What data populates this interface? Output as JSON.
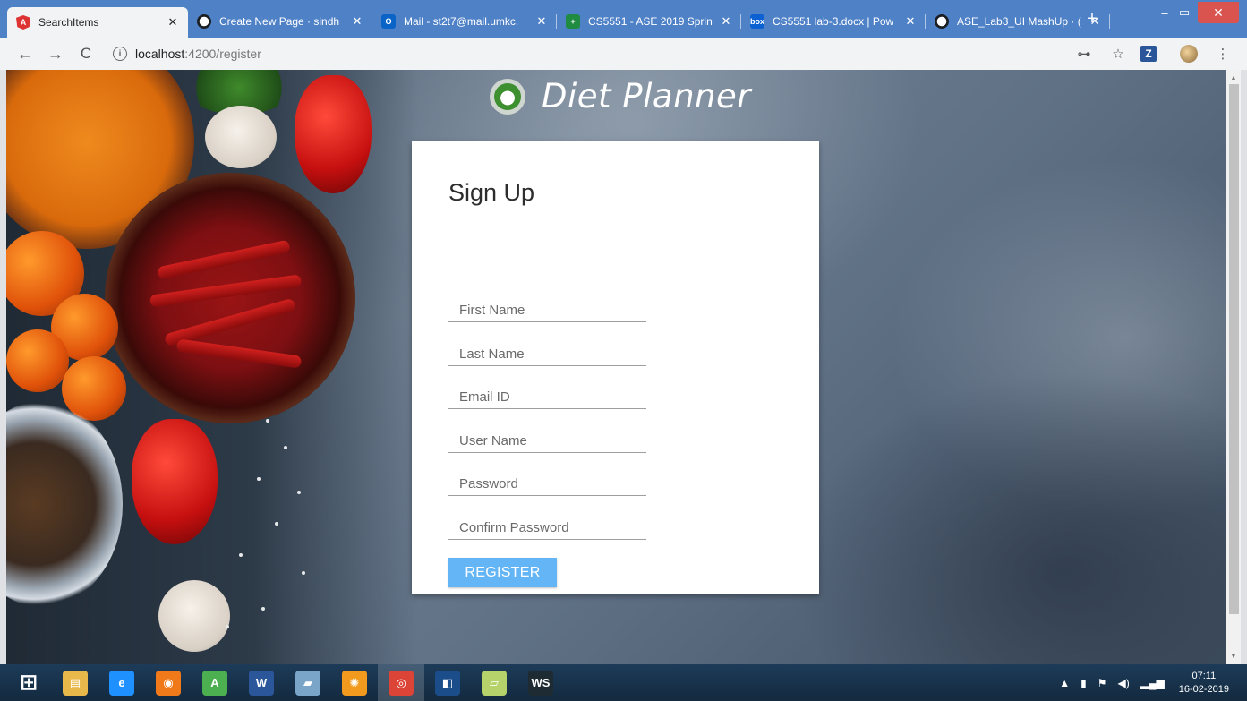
{
  "browser": {
    "tabs": [
      {
        "title": "SearchItems",
        "favicon": "angular-icon",
        "favicon_color": "#dd3333",
        "favicon_text": "A",
        "active": true
      },
      {
        "title": "Create New Page · sindh",
        "favicon": "github-icon",
        "favicon_color": "#ffffff",
        "favicon_text": "",
        "active": false
      },
      {
        "title": "Mail - st2t7@mail.umkc.",
        "favicon": "outlook-icon",
        "favicon_color": "#0a64c8",
        "favicon_text": "O",
        "active": false
      },
      {
        "title": "CS5551 - ASE 2019 Sprin",
        "favicon": "spreadsheet-icon",
        "favicon_color": "#1f8c42",
        "favicon_text": "+",
        "active": false
      },
      {
        "title": "CS5551 lab-3.docx | Pow",
        "favicon": "box-icon",
        "favicon_color": "#0b61d2",
        "favicon_text": "box",
        "active": false
      },
      {
        "title": "ASE_Lab3_UI MashUp · (",
        "favicon": "github-icon",
        "favicon_color": "#ffffff",
        "favicon_text": "",
        "active": false
      }
    ],
    "new_tab_label": "+",
    "window_controls": {
      "minimize": "–",
      "maximize": "▭",
      "close": "✕"
    },
    "nav": {
      "back": "←",
      "forward": "→",
      "reload": "C"
    },
    "address": {
      "host": "localhost",
      "rest": ":4200/register"
    },
    "toolbar_icons": {
      "key": "⊶",
      "star": "☆",
      "ext_z": "Z",
      "menu": "⋮"
    }
  },
  "page": {
    "brand_title": "Diet Planner",
    "signup": {
      "title": "Sign Up",
      "fields": [
        {
          "placeholder": "First Name"
        },
        {
          "placeholder": "Last Name"
        },
        {
          "placeholder": "Email ID"
        },
        {
          "placeholder": "User Name"
        },
        {
          "placeholder": "Password"
        },
        {
          "placeholder": "Confirm Password"
        }
      ],
      "register_label": "REGISTER"
    }
  },
  "taskbar": {
    "apps": [
      {
        "name": "windows-start-icon",
        "glyph": "⊞",
        "color": "#1d3b58"
      },
      {
        "name": "file-explorer-icon",
        "glyph": "▤",
        "color": "#e8b84a"
      },
      {
        "name": "internet-explorer-icon",
        "glyph": "e",
        "color": "#1e90ff"
      },
      {
        "name": "firefox-icon",
        "glyph": "◉",
        "color": "#f07a1a"
      },
      {
        "name": "android-studio-icon",
        "glyph": "A",
        "color": "#4caf50"
      },
      {
        "name": "word-icon",
        "glyph": "W",
        "color": "#2b579a"
      },
      {
        "name": "notepad-icon",
        "glyph": "▰",
        "color": "#7aa4c8"
      },
      {
        "name": "settings-gear-icon",
        "glyph": "✺",
        "color": "#f29a1d"
      },
      {
        "name": "chrome-icon",
        "glyph": "◎",
        "color": "#db4437"
      },
      {
        "name": "jetbrains-icon",
        "glyph": "◧",
        "color": "#1b4d8a"
      },
      {
        "name": "sticky-notes-icon",
        "glyph": "▱",
        "color": "#b5d36a"
      },
      {
        "name": "webstorm-icon",
        "glyph": "WS",
        "color": "#1e2b33"
      }
    ],
    "active_app_index": 8,
    "tray": {
      "chevron": "▲",
      "clock_time": "07:11",
      "clock_date": "16-02-2019"
    }
  }
}
